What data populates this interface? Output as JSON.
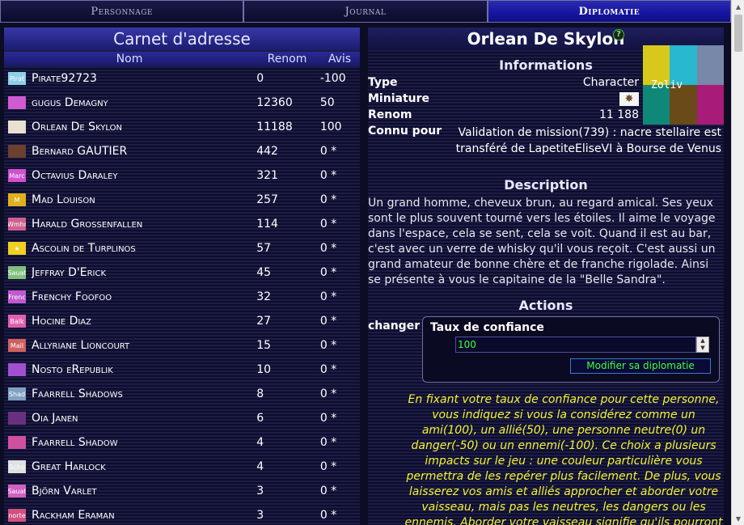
{
  "tabs": [
    "Personnage",
    "Journal",
    "Diplomatie"
  ],
  "left": {
    "title": "Carnet d'adresse",
    "col_name": "Nom",
    "col_renom": "Renom",
    "col_avis": "Avis",
    "contacts": [
      {
        "name": "Pirate92723",
        "renom": "0",
        "avis": "-100",
        "icon_text": "Pirat",
        "icon_color": "#8fd0e8"
      },
      {
        "name": "gugus Demagny",
        "renom": "12360",
        "avis": "50",
        "icon_text": "",
        "icon_color": "#d05ad0"
      },
      {
        "name": "Orlean De Skylon",
        "renom": "11188",
        "avis": "100",
        "icon_text": "",
        "icon_color": "#e8e0d0"
      },
      {
        "name": "Bernard GAUTIER",
        "renom": "442",
        "avis": "0 *",
        "icon_text": "",
        "icon_color": "#6a4030"
      },
      {
        "name": "Octavius Daraley",
        "renom": "321",
        "avis": "0 *",
        "icon_text": "Marc",
        "icon_color": "#d050d0"
      },
      {
        "name": "Mad Louison",
        "renom": "257",
        "avis": "0 *",
        "icon_text": "M",
        "icon_color": "#e0b020"
      },
      {
        "name": "Harald Grossenfallen",
        "renom": "114",
        "avis": "0 *",
        "icon_text": "Wmhr",
        "icon_color": "#d06090"
      },
      {
        "name": "Ascolin de Turplinos",
        "renom": "57",
        "avis": "0 *",
        "icon_text": "★",
        "icon_color": "#f0d020"
      },
      {
        "name": "Jeffray D'Erick",
        "renom": "45",
        "avis": "0 *",
        "icon_text": "Sauat",
        "icon_color": "#80c080"
      },
      {
        "name": "Frenchy Foofoo",
        "renom": "32",
        "avis": "0 *",
        "icon_text": "Frenc",
        "icon_color": "#c05ad0"
      },
      {
        "name": "Hocine Diaz",
        "renom": "27",
        "avis": "0 *",
        "icon_text": "Balk",
        "icon_color": "#e060b0"
      },
      {
        "name": "Allyriane Lioncourt",
        "renom": "15",
        "avis": "0 *",
        "icon_text": "Mail",
        "icon_color": "#d06060"
      },
      {
        "name": "Nosto eRepublik",
        "renom": "10",
        "avis": "0 *",
        "icon_text": "",
        "icon_color": "#a050d0"
      },
      {
        "name": "Faarrell Shadows",
        "renom": "8",
        "avis": "0 *",
        "icon_text": "Shad",
        "icon_color": "#80a0c0"
      },
      {
        "name": "Oia Janen",
        "renom": "6",
        "avis": "0 *",
        "icon_text": "",
        "icon_color": "#6a3080"
      },
      {
        "name": "Faarrell Shadow",
        "renom": "4",
        "avis": "0 *",
        "icon_text": "",
        "icon_color": "#d050a0"
      },
      {
        "name": "Great Harlock",
        "renom": "4",
        "avis": "0 *",
        "icon_text": "Scho",
        "icon_color": "#e0e0e0"
      },
      {
        "name": "Björn Varlet",
        "renom": "3",
        "avis": "0 *",
        "icon_text": "Sauat",
        "icon_color": "#d060c0"
      },
      {
        "name": "Rackham Eraman",
        "renom": "3",
        "avis": "0 *",
        "icon_text": "norte",
        "icon_color": "#d05080"
      }
    ]
  },
  "right": {
    "name": "Orlean De Skylon",
    "help": "?",
    "informations_title": "Informations",
    "type_label": "Type",
    "type_value": "Character",
    "miniature_label": "Miniature",
    "renom_label": "Renom",
    "renom_value": "11 188",
    "connu_label": "Connu pour",
    "connu_value": "Validation de mission(739) : nacre stellaire est transféré de LapetiteEliseVI à Bourse de Venus",
    "mosaic_text": "Zoliv",
    "mosaic_colors": [
      "#d8c81c",
      "#28b8d0",
      "#7888a8",
      "#108878",
      "#6a4a18",
      "#a81c78"
    ],
    "description_title": "Description",
    "description": "Un grand homme, cheveux brun, au regard amical. Ses yeux sont le plus souvent tourné vers les étoiles. Il aime le voyage dans l'espace, cela se sent, cela se voit. Quand il est au bar, c'est avec un verre de whisky qu'il vous reçoit. C'est aussi un grand amateur de bonne chère et de franche rigolade. Ainsi se présente à vous le capitaine de la \"Belle Sandra\".",
    "actions_title": "Actions",
    "changer_label": "changer",
    "trust_title": "Taux de confiance",
    "trust_value": "100",
    "modify_button": "Modifier sa diplomatie",
    "explanation": "En fixant votre taux de confiance pour cette personne, vous indiquez si vous la considérez comme un ami(100), un allié(50), une personne neutre(0) un danger(-50) ou un ennemi(-100). Ce choix a plusieurs impacts sur le jeu : une couleur particulière vous permettra de les repérer plus facilement. De plus, vous laisserez vos amis et alliés approcher et aborder votre vaisseau, mais pas les neutres, les dangers ou les ennemis. Aborder votre vaisseau signifie qu'ils pourront vous attaquer."
  }
}
